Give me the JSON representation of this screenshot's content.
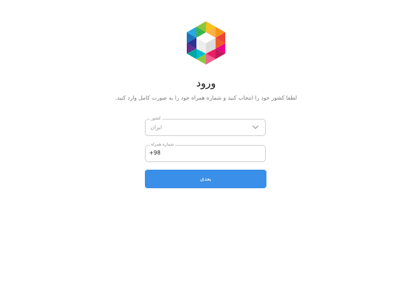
{
  "login": {
    "title": "ورود",
    "subtitle": "لطفا کشور خود را انتخاب کنید و شماره همراه خود را به صورت کامل وارد کنید."
  },
  "country_field": {
    "label": "کشور",
    "value": "ایران",
    "icon": "chevron-down-icon"
  },
  "phone_field": {
    "label": "شماره همراه",
    "value": "+98"
  },
  "next_button": {
    "label": "بعدی"
  },
  "brand": {
    "logo_icon": "rubika-cube-logo"
  },
  "colors": {
    "button": "#3a8fe8",
    "border": "#cfcfcf"
  }
}
